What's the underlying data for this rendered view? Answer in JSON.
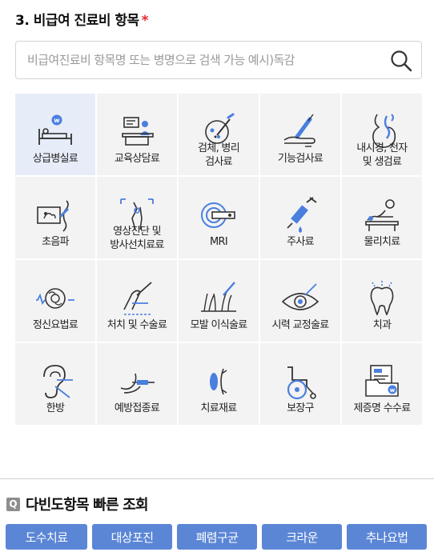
{
  "section": {
    "title": "3. 비급여 진료비 항목",
    "required_mark": "*"
  },
  "search": {
    "placeholder": "비급여진료비 항목명 또는 병명으로 검색 가능 예시)독감",
    "value": ""
  },
  "categories": [
    {
      "label": "상급병실료",
      "icon": "hospital-bed-icon",
      "selected": true
    },
    {
      "label": "교육상담료",
      "icon": "counseling-desk-icon"
    },
    {
      "label": "검체, 병리\n검사료",
      "icon": "specimen-test-icon"
    },
    {
      "label": "기능검사료",
      "icon": "arm-injection-icon"
    },
    {
      "label": "내시경, 천자\n및 생검료",
      "icon": "endoscope-stomach-icon"
    },
    {
      "label": "초음파",
      "icon": "ultrasound-icon"
    },
    {
      "label": "영상진단 및\n방사선치료료",
      "icon": "xray-bone-icon"
    },
    {
      "label": "MRI",
      "icon": "mri-machine-icon"
    },
    {
      "label": "주사료",
      "icon": "syringe-icon"
    },
    {
      "label": "물리치료",
      "icon": "physical-therapy-icon"
    },
    {
      "label": "정신요법료",
      "icon": "brain-pulse-icon"
    },
    {
      "label": "처치 및 수술료",
      "icon": "scalpel-hand-icon"
    },
    {
      "label": "모발 이식술료",
      "icon": "hair-transplant-icon"
    },
    {
      "label": "시력 교정술료",
      "icon": "eye-laser-icon"
    },
    {
      "label": "치과",
      "icon": "tooth-icon"
    },
    {
      "label": "한방",
      "icon": "ear-acupuncture-icon"
    },
    {
      "label": "예방접종료",
      "icon": "vaccine-arm-icon"
    },
    {
      "label": "치료재료",
      "icon": "lens-material-icon"
    },
    {
      "label": "보장구",
      "icon": "wheelchair-icon"
    },
    {
      "label": "제증명 수수료",
      "icon": "certificate-folder-icon"
    }
  ],
  "quick": {
    "badge": "Q",
    "title": "다빈도항목 빠른 조회",
    "items": [
      "도수치료",
      "대상포진",
      "폐렴구균",
      "크라운",
      "추나요법"
    ]
  },
  "colors": {
    "accent": "#5b86d6",
    "icon_blue": "#4a7fe0",
    "required": "#e8262c",
    "selected_bg": "#e6ecf8",
    "cell_bg": "#f3f3f3"
  }
}
